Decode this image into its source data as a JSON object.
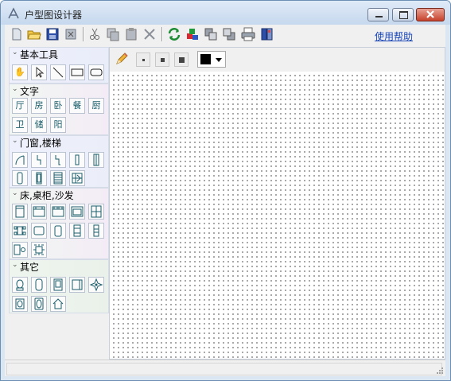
{
  "window": {
    "title": "户型图设计器"
  },
  "toolbar": {
    "buttons": [
      "new-icon",
      "open-icon",
      "save-icon",
      "close-doc-icon",
      "cut-icon",
      "copy-icon",
      "paste-icon",
      "delete-icon",
      "refresh-icon",
      "layers-icon",
      "bring-front-icon",
      "send-back-icon",
      "print-icon",
      "export-icon"
    ],
    "help_label": "使用帮助"
  },
  "groups": [
    {
      "title": "基本工具",
      "tools": [
        "hand-icon",
        "pointer-icon",
        "line-icon",
        "rectangle-icon",
        "rounded-rect-icon"
      ]
    },
    {
      "title": "文字",
      "tools": [
        "厅",
        "房",
        "卧",
        "餐",
        "厨",
        "卫",
        "储",
        "阳"
      ]
    },
    {
      "title": "门窗,楼梯",
      "tools": [
        "arc-door-icon",
        "door-1-icon",
        "door-2-icon",
        "window-1-icon",
        "window-2-icon",
        "window-3-icon",
        "window-4-icon",
        "stairs-icon",
        "stairs-2-icon"
      ]
    },
    {
      "title": "床,桌柜,沙发",
      "tools": [
        "bed-1-icon",
        "bed-2-icon",
        "bed-3-icon",
        "sofa-1-icon",
        "cabinet-1-icon",
        "table-chairs-icon",
        "table-icon",
        "sofa-2-icon",
        "cabinet-2-icon",
        "cabinet-3-icon",
        "desk-chair-icon",
        "dining-table-icon"
      ]
    },
    {
      "title": "其它",
      "tools": [
        "toilet-icon",
        "bathtub-icon",
        "washer-icon",
        "fridge-icon",
        "plant-icon",
        "sink-icon",
        "tv-icon",
        "house-icon"
      ]
    }
  ],
  "canvas": {
    "line_styles": [
      "thin",
      "medium",
      "thick"
    ],
    "color": "#000000"
  },
  "status": {
    "text": ""
  }
}
